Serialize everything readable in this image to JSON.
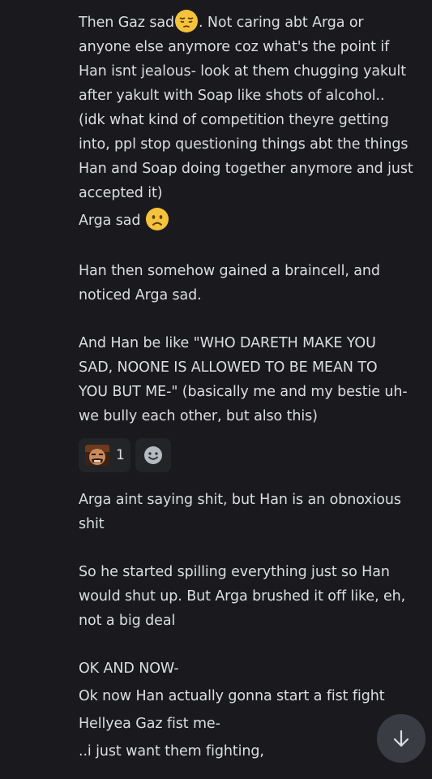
{
  "messages": [
    {
      "lines": [
        "Then Gaz sad",
        ". Not caring abt Arga or",
        "anyone else anymore coz what's the point if",
        "Han isnt jealous- look at them chugging yakult",
        "after yakult with Soap like shots of alcohol..",
        "(idk what kind of competition theyre getting",
        "into, ppl stop questioning things abt the things",
        "Han and Soap doing together anymore and just",
        "accepted it)",
        "Arga sad"
      ],
      "emojis": [
        "pensive-face-emoji",
        "frowning-face-emoji"
      ]
    },
    {
      "lines": [
        "Han then somehow gained a braincell, and",
        "noticed Arga sad."
      ]
    },
    {
      "lines": [
        "And Han be like \"WHO DARETH MAKE YOU",
        "SAD, NOONE IS ALLOWED TO BE MEAN TO",
        "YOU BUT ME-\" (basically me and my bestie uh-",
        "we bully each other, but also this)"
      ]
    },
    {
      "lines": [
        "Arga aint saying shit, but Han is an obnoxious",
        "shit"
      ]
    },
    {
      "lines": [
        "So he started spilling everything just so Han",
        "would shut up. But Arga brushed it off like, eh,",
        "not a big deal"
      ]
    },
    {
      "lines": [
        "OK AND NOW-",
        "Ok now Han actually gonna start a fist fight",
        "Hellyea Gaz fist me-",
        "..i just want them fighting,"
      ]
    }
  ],
  "reactions": {
    "count": "1",
    "icon": "custom-emoji-reaction",
    "add_icon": "add-reaction-icon"
  },
  "scroll_button": {
    "icon": "arrow-down-icon"
  },
  "colors": {
    "background": "#1a1a1e",
    "text": "#dbdee1",
    "reaction_bg": "#232428",
    "scroll_button_bg": "#3a3c43",
    "emoji_yellow": "#f5c33b"
  }
}
